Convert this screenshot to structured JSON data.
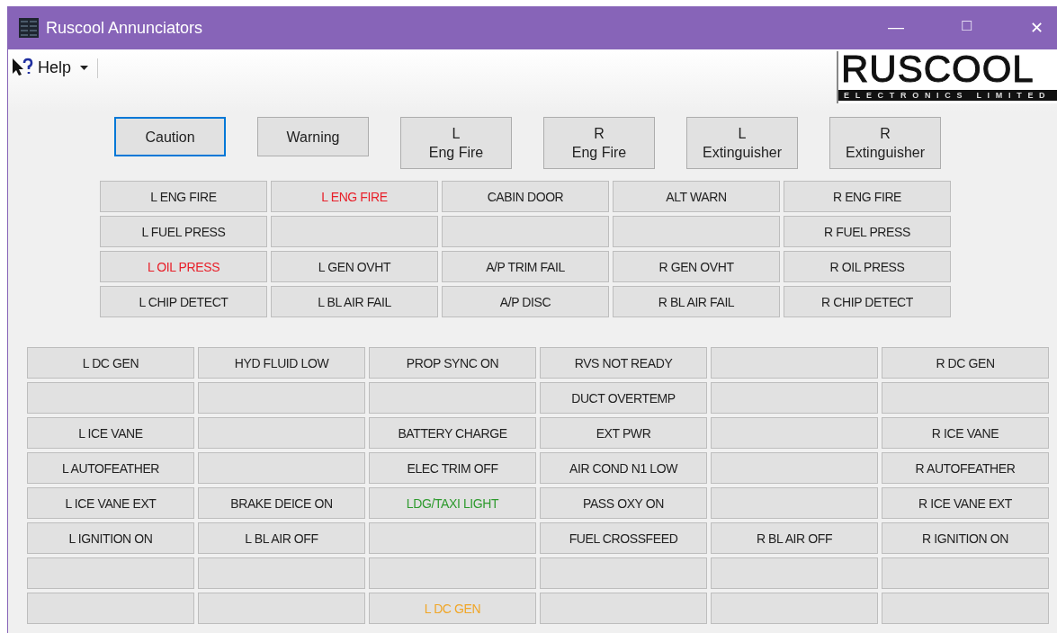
{
  "window": {
    "title": "Ruscool Annunciators",
    "controls": [
      {
        "glyph": "—",
        "disabled": false
      },
      {
        "glyph": "☐",
        "disabled": true
      },
      {
        "glyph": "✕",
        "disabled": false
      }
    ]
  },
  "menu": {
    "label": "Help"
  },
  "logo": {
    "name": "RUSCOOL",
    "tagline": "ELECTRONICS LIMITED"
  },
  "buttons": [
    {
      "lines": [
        "Caution"
      ],
      "selected": true
    },
    {
      "lines": [
        "Warning"
      ],
      "selected": false
    },
    {
      "lines": [
        "L",
        "Eng Fire"
      ],
      "selected": false
    },
    {
      "lines": [
        "R",
        "Eng Fire"
      ],
      "selected": false
    },
    {
      "lines": [
        "L",
        "Extinguisher"
      ],
      "selected": false
    },
    {
      "lines": [
        "R",
        "Extinguisher"
      ],
      "selected": false
    }
  ],
  "upper_panel": [
    [
      {
        "kind": "lit",
        "text": "L ENG FIRE"
      },
      {
        "kind": "lit",
        "text": "L ENG FIRE",
        "color": "#e8202a"
      },
      {
        "kind": "lit",
        "text": "CABIN DOOR"
      },
      {
        "kind": "lit",
        "text": "ALT WARN"
      },
      {
        "kind": "lit",
        "text": "R ENG FIRE"
      }
    ],
    [
      {
        "kind": "lit",
        "text": "L FUEL PRESS"
      },
      {
        "kind": "blank"
      },
      {
        "kind": "blank"
      },
      {
        "kind": "blank"
      },
      {
        "kind": "lit",
        "text": "R FUEL PRESS"
      }
    ],
    [
      {
        "kind": "lit",
        "text": "L OIL PRESS",
        "color": "#e8202a"
      },
      {
        "kind": "lit",
        "text": "L GEN OVHT"
      },
      {
        "kind": "lit",
        "text": "A/P TRIM FAIL"
      },
      {
        "kind": "lit",
        "text": "R GEN OVHT"
      },
      {
        "kind": "lit",
        "text": "R OIL PRESS"
      }
    ],
    [
      {
        "kind": "lit",
        "text": "L CHIP DETECT"
      },
      {
        "kind": "lit",
        "text": "L BL AIR FAIL"
      },
      {
        "kind": "lit",
        "text": "A/P DISC"
      },
      {
        "kind": "lit",
        "text": "R BL AIR FAIL"
      },
      {
        "kind": "lit",
        "text": "R CHIP DETECT"
      }
    ]
  ],
  "lower_panel": [
    [
      {
        "kind": "lit",
        "text": "L DC GEN"
      },
      {
        "kind": "lit",
        "text": "HYD FLUID LOW"
      },
      {
        "kind": "lit",
        "text": "PROP SYNC ON"
      },
      {
        "kind": "lit",
        "text": "RVS NOT READY"
      },
      {
        "kind": "blank"
      },
      {
        "kind": "lit",
        "text": "R DC GEN"
      }
    ],
    [
      {
        "kind": "blank"
      },
      {
        "kind": "blank"
      },
      {
        "kind": "blank"
      },
      {
        "kind": "lit",
        "text": "DUCT OVERTEMP"
      },
      {
        "kind": "blank"
      },
      {
        "kind": "blank"
      }
    ],
    [
      {
        "kind": "lit",
        "text": "L ICE VANE"
      },
      {
        "kind": "blank"
      },
      {
        "kind": "lit",
        "text": "BATTERY CHARGE"
      },
      {
        "kind": "lit",
        "text": "EXT PWR"
      },
      {
        "kind": "blank"
      },
      {
        "kind": "lit",
        "text": "R ICE VANE"
      }
    ],
    [
      {
        "kind": "lit",
        "text": "L AUTOFEATHER"
      },
      {
        "kind": "blank"
      },
      {
        "kind": "lit",
        "text": "ELEC TRIM OFF"
      },
      {
        "kind": "lit",
        "text": "AIR COND N1 LOW"
      },
      {
        "kind": "blank"
      },
      {
        "kind": "lit",
        "text": "R AUTOFEATHER"
      }
    ],
    [
      {
        "kind": "lit",
        "text": "L ICE VANE EXT"
      },
      {
        "kind": "lit",
        "text": "BRAKE DEICE ON"
      },
      {
        "kind": "lit",
        "text": "LDG/TAXI LIGHT",
        "color": "#2e9a2e"
      },
      {
        "kind": "lit",
        "text": "PASS OXY ON"
      },
      {
        "kind": "blank"
      },
      {
        "kind": "lit",
        "text": "R ICE VANE EXT"
      }
    ],
    [
      {
        "kind": "lit",
        "text": "L IGNITION ON"
      },
      {
        "kind": "lit",
        "text": "L BL AIR OFF"
      },
      {
        "kind": "blank"
      },
      {
        "kind": "lit",
        "text": "FUEL CROSSFEED"
      },
      {
        "kind": "lit",
        "text": "R BL AIR OFF"
      },
      {
        "kind": "lit",
        "text": "R IGNITION ON"
      }
    ],
    [
      {
        "kind": "blank"
      },
      {
        "kind": "blank"
      },
      {
        "kind": "blank"
      },
      {
        "kind": "blank"
      },
      {
        "kind": "blank"
      },
      {
        "kind": "blank"
      }
    ],
    [
      {
        "kind": "blank"
      },
      {
        "kind": "blank"
      },
      {
        "kind": "lit",
        "text": "L DC GEN",
        "color": "#f0a628"
      },
      {
        "kind": "blank"
      },
      {
        "kind": "blank"
      },
      {
        "kind": "blank"
      }
    ]
  ]
}
